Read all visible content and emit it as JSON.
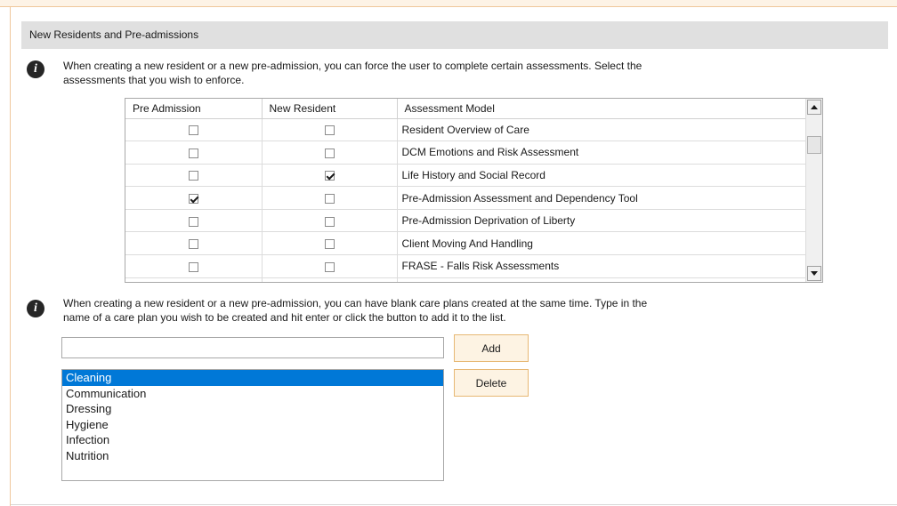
{
  "section": {
    "title": "New Residents and Pre-admissions"
  },
  "assessments": {
    "description": "When creating a new resident or a new pre-admission, you can force the user to complete certain assessments. Select the assessments that you wish to enforce.",
    "description_line1": "When creating a new resident or a new pre-admission, you can force the user to complete certain assessments. Select the",
    "description_line2": "assessments that you wish to enforce.",
    "columns": [
      "Pre Admission",
      "New Resident",
      "Assessment Model"
    ],
    "rows": [
      {
        "pre_admission": false,
        "new_resident": false,
        "model": "Resident Overview of Care"
      },
      {
        "pre_admission": false,
        "new_resident": false,
        "model": "DCM Emotions and Risk Assessment"
      },
      {
        "pre_admission": false,
        "new_resident": true,
        "model": "Life History and Social Record"
      },
      {
        "pre_admission": true,
        "new_resident": false,
        "model": "Pre-Admission Assessment and Dependency Tool"
      },
      {
        "pre_admission": false,
        "new_resident": false,
        "model": "Pre-Admission Deprivation of Liberty"
      },
      {
        "pre_admission": false,
        "new_resident": false,
        "model": "Client Moving And Handling"
      },
      {
        "pre_admission": false,
        "new_resident": false,
        "model": "FRASE - Falls Risk Assessments"
      },
      {
        "pre_admission": false,
        "new_resident": false,
        "model": ""
      }
    ]
  },
  "careplans": {
    "description_line1": "When creating a new resident or a new pre-admission, you can have blank care plans created at the same time. Type in the",
    "description_line2": "name of a care plan you wish to be created and hit enter or click the button to add it to the list.",
    "input_value": "",
    "add_label": "Add",
    "delete_label": "Delete",
    "items": [
      "Cleaning",
      "Communication",
      "Dressing",
      "Hygiene",
      "Infection",
      "Nutrition"
    ],
    "selected_index": 0
  },
  "icons": {
    "info": "info-icon"
  },
  "colors": {
    "button_bg": "#fdf3e3",
    "button_border": "#e7b874",
    "selection": "#0078d7",
    "header_bg": "#e0e0e0"
  }
}
